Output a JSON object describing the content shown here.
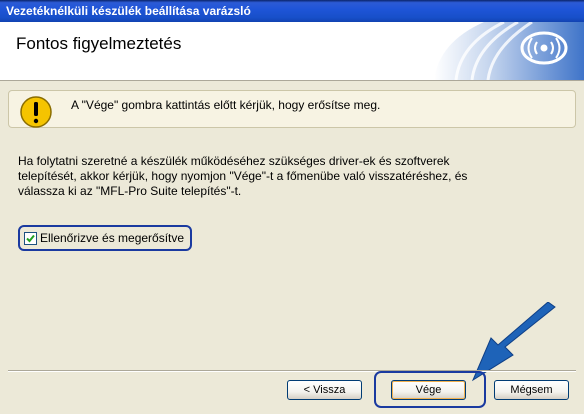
{
  "window": {
    "title": "Vezetéknélküli készülék beállítása varázsló"
  },
  "header": {
    "title": "Fontos figyelmeztetés"
  },
  "warning": {
    "text": "A \"Vége\" gombra kattintás előtt kérjük, hogy erősítse meg."
  },
  "body": {
    "line1": "Ha folytatni szeretné a készülék működéséhez szükséges driver-ek és szoftverek",
    "line2": "telepítését, akkor kérjük, hogy nyomjon \"Vége\"-t a főmenübe való visszatéréshez, és",
    "line3": "válassza ki az \"MFL-Pro Suite telepítés\"-t."
  },
  "confirm": {
    "label": "Ellenőrizve és megerősítve",
    "checked": true
  },
  "buttons": {
    "back": "< Vissza",
    "finish": "Vége",
    "cancel": "Mégsem"
  },
  "colors": {
    "highlight": "#1a3aa0",
    "titlebar": "#1f55d8",
    "arrow": "#1e63b8"
  }
}
